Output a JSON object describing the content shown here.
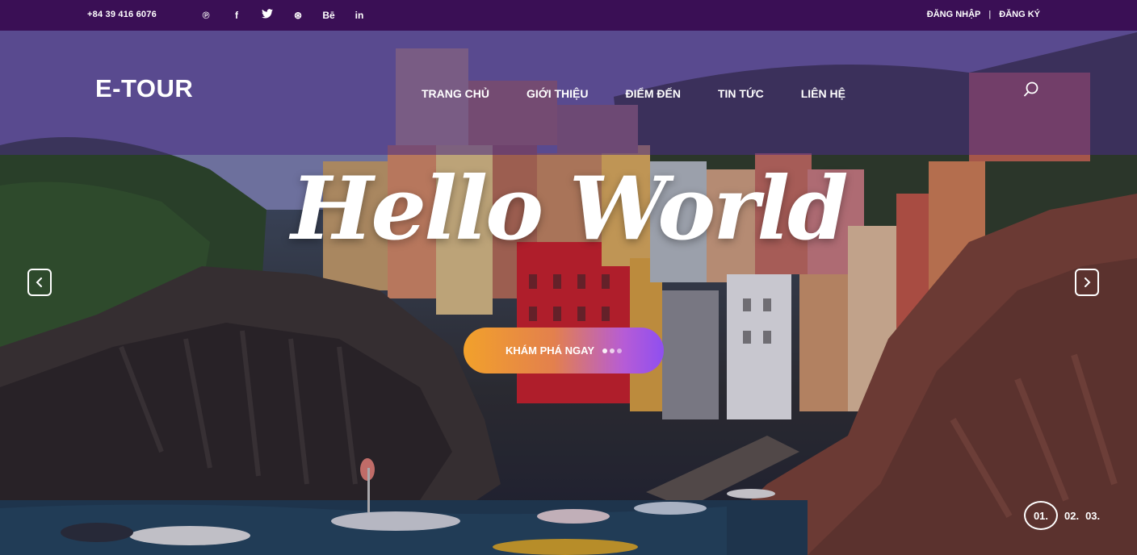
{
  "topbar": {
    "phone": "+84 39 416 6076",
    "social_icons": [
      "pinterest-icon",
      "facebook-icon",
      "twitter-icon",
      "dribbble-icon",
      "behance-icon",
      "linkedin-icon"
    ],
    "social_glyphs": [
      "℗",
      "f",
      "🐦",
      "⊛",
      "Bē",
      "in"
    ],
    "login": "ĐĂNG NHẬP",
    "separator": "|",
    "register": "ĐĂNG KÝ"
  },
  "header": {
    "logo": "E-TOUR",
    "nav": [
      "TRANG CHỦ",
      "GIỚI THIỆU",
      "ĐIỂM ĐẾN",
      "TIN TỨC",
      "LIÊN HỆ"
    ]
  },
  "hero": {
    "title": "Hello World",
    "cta_label": "KHÁM PHÁ NGAY",
    "pages": [
      "01.",
      "02.",
      "03."
    ],
    "active_page": "01."
  },
  "colors": {
    "topbar": "#3a0f55",
    "header_overlay": "#482c84",
    "cta_start": "#f2a12b",
    "cta_end": "#8f4ff0"
  }
}
